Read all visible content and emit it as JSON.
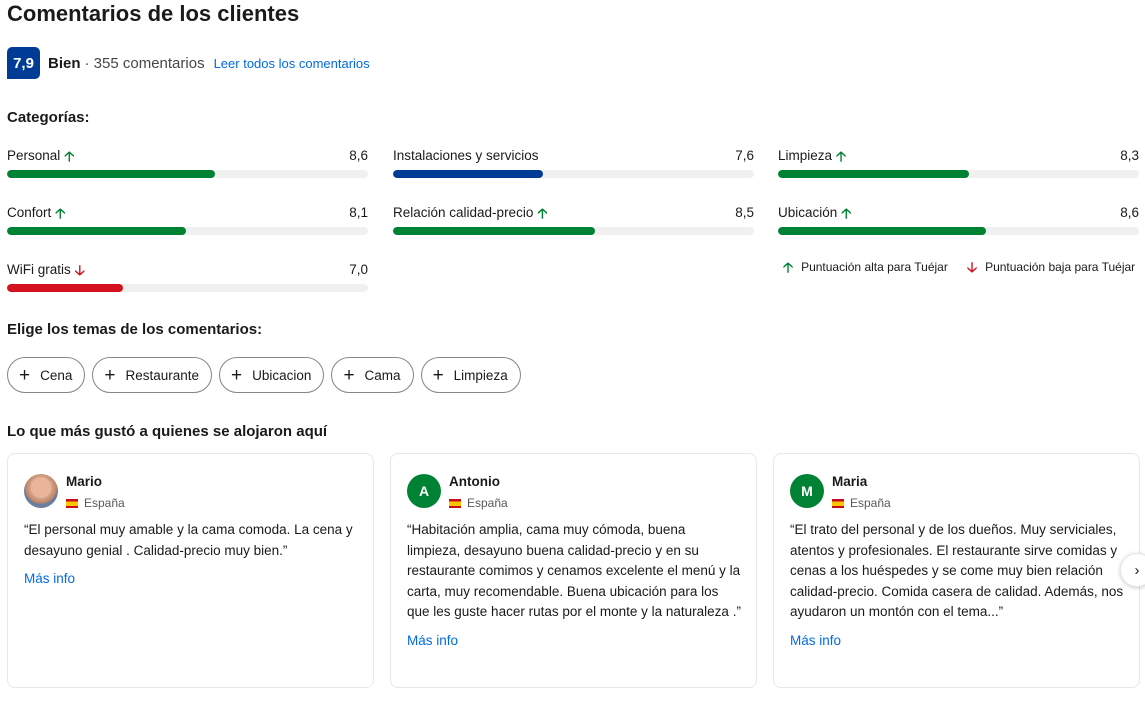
{
  "page_title": "Comentarios de los clientes",
  "summary": {
    "score": "7,9",
    "score_word": "Bien",
    "count_text": "· 355 comentarios",
    "read_all_link": "Leer todos los comentarios",
    "score_color": "#003b95"
  },
  "categories_heading": "Categorías:",
  "categories": [
    {
      "label": "Personal",
      "value": "8,6",
      "score": 8.6,
      "trend": "up",
      "arrow": "🡡",
      "color": "#008234"
    },
    {
      "label": "Instalaciones y servicios",
      "value": "7,6",
      "score": 7.6,
      "trend": "none",
      "arrow": "",
      "color": "#003b95"
    },
    {
      "label": "Limpieza",
      "value": "8,3",
      "score": 8.3,
      "trend": "up",
      "arrow": "🡡",
      "color": "#008234"
    },
    {
      "label": "Confort",
      "value": "8,1",
      "score": 8.1,
      "trend": "up",
      "arrow": "🡡",
      "color": "#008234"
    },
    {
      "label": "Relación calidad-precio",
      "value": "8,5",
      "score": 8.5,
      "trend": "up",
      "arrow": "🡡",
      "color": "#008234"
    },
    {
      "label": "Ubicación",
      "value": "8,6",
      "score": 8.6,
      "trend": "up",
      "arrow": "🡡",
      "color": "#008234"
    },
    {
      "label": "WiFi gratis",
      "value": "7,0",
      "score": 7.0,
      "trend": "down",
      "arrow": "🡣",
      "color": "#d4111e"
    }
  ],
  "legend": {
    "high": {
      "arrow": "🡡",
      "text": "Puntuación alta para Tuéjar"
    },
    "low": {
      "arrow": "🡣",
      "text": "Puntuación baja para Tuéjar"
    }
  },
  "topics_heading": "Elige los temas de los comentarios:",
  "topics": [
    {
      "plus": "+",
      "label": "Cena"
    },
    {
      "plus": "+",
      "label": "Restaurante"
    },
    {
      "plus": "+",
      "label": "Ubicacion"
    },
    {
      "plus": "+",
      "label": "Cama"
    },
    {
      "plus": "+",
      "label": "Limpieza"
    }
  ],
  "liked_heading": "Lo que más gustó a quienes se alojaron aquí",
  "reviews": [
    {
      "name": "Mario",
      "initial": "",
      "avatar": "photo",
      "country": "España",
      "text": "“El personal muy amable y la cama comoda. La cena y desayuno genial . Calidad-precio muy bien.”",
      "more": "Más info"
    },
    {
      "name": "Antonio",
      "initial": "A",
      "avatar": "green",
      "country": "España",
      "text": "“Habitación amplia, cama muy cómoda, buena limpieza, desayuno buena calidad-precio y en su restaurante comimos y cenamos excelente el menú y la carta, muy recomendable. Buena ubicación para los que les guste hacer rutas por el monte y la naturaleza .”",
      "more": "Más info"
    },
    {
      "name": "Maria",
      "initial": "M",
      "avatar": "green",
      "country": "España",
      "text": "“El trato del personal y de los dueños. Muy serviciales, atentos y profesionales. El restaurante sirve comidas y cenas a los huéspedes y se come muy bien relación calidad-precio. Comida casera de calidad. Además, nos ayudaron un montón con el tema...”",
      "more": "Más info"
    }
  ],
  "carousel_next_icon": "›"
}
